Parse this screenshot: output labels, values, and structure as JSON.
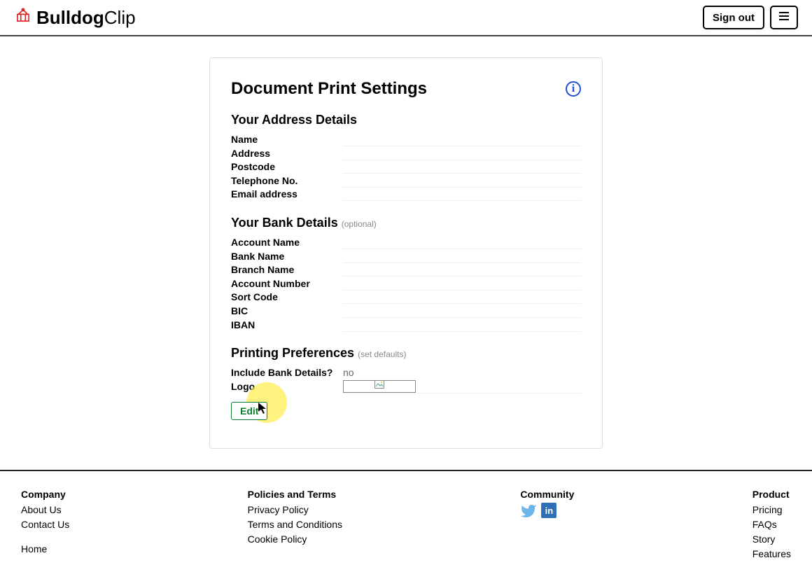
{
  "header": {
    "brand_bold": "Bulldog",
    "brand_light": "Clip",
    "sign_out": "Sign out"
  },
  "page": {
    "title": "Document Print Settings"
  },
  "address": {
    "heading": "Your Address Details",
    "fields": {
      "name_label": "Name",
      "address_label": "Address",
      "postcode_label": "Postcode",
      "telephone_label": "Telephone No.",
      "email_label": "Email address"
    }
  },
  "bank": {
    "heading": "Your Bank Details",
    "heading_sub": "(optional)",
    "fields": {
      "account_name_label": "Account Name",
      "bank_name_label": "Bank Name",
      "branch_name_label": "Branch Name",
      "account_number_label": "Account Number",
      "sort_code_label": "Sort Code",
      "bic_label": "BIC",
      "iban_label": "IBAN"
    }
  },
  "printing": {
    "heading": "Printing Preferences",
    "heading_sub": "(set defaults)",
    "include_bank_label": "Include Bank Details?",
    "include_bank_value": "no",
    "logo_label": "Logo"
  },
  "buttons": {
    "edit": "Edit"
  },
  "footer": {
    "company": {
      "title": "Company",
      "about": "About Us",
      "contact": "Contact Us",
      "home": "Home"
    },
    "policies": {
      "title": "Policies and Terms",
      "privacy": "Privacy Policy",
      "terms": "Terms and Conditions",
      "cookie": "Cookie Policy"
    },
    "community": {
      "title": "Community"
    },
    "product": {
      "title": "Product",
      "pricing": "Pricing",
      "faqs": "FAQs",
      "story": "Story",
      "features": "Features"
    }
  }
}
